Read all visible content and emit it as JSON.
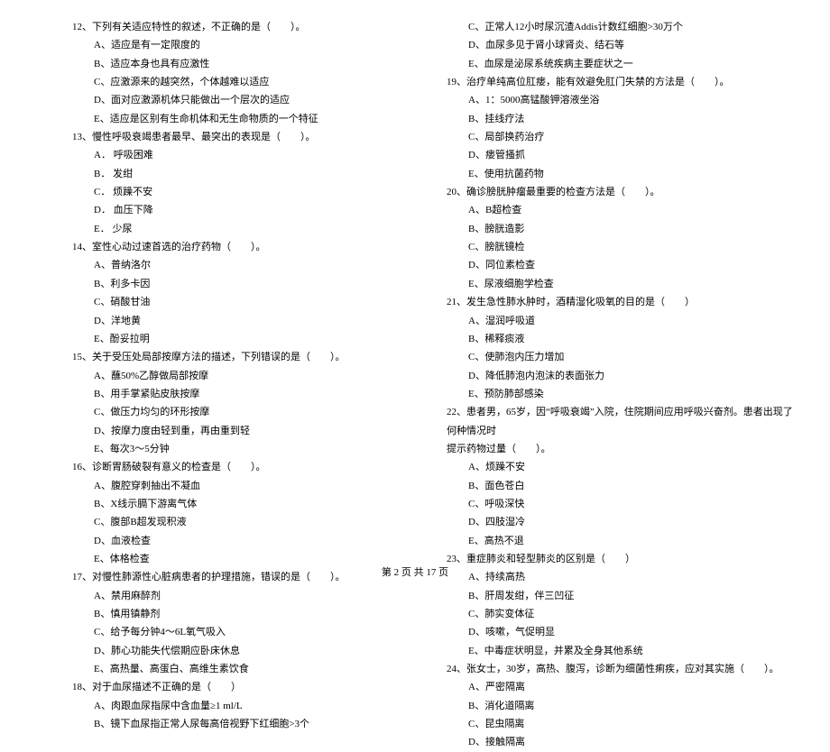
{
  "left": {
    "q12": {
      "stem": "12、下列有关适应特性的叙述，不正确的是（　　）。",
      "A": "A、适应是有一定限度的",
      "B": "B、适应本身也具有应激性",
      "C": "C、应激源来的越突然，个体越难以适应",
      "D": "D、面对应激源机体只能做出一个层次的适应",
      "E": "E、适应是区别有生命机体和无生命物质的一个特征"
    },
    "q13": {
      "stem": "13、慢性呼吸衰竭患者最早、最突出的表现是（　　）。",
      "A": "A． 呼吸困难",
      "B": "B． 发绀",
      "C": "C． 烦躁不安",
      "D": "D． 血压下降",
      "E": "E． 少尿"
    },
    "q14": {
      "stem": "14、室性心动过速首选的治疗药物（　　）。",
      "A": "A、普纳洛尔",
      "B": "B、利多卡因",
      "C": "C、硝酸甘油",
      "D": "D、洋地黄",
      "E": "E、酚妥拉明"
    },
    "q15": {
      "stem": "15、关于受压处局部按摩方法的描述，下列错误的是（　　）。",
      "A": "A、蘸50%乙醇做局部按摩",
      "B": "B、用手掌紧贴皮肤按摩",
      "C": "C、做压力均匀的环形按摩",
      "D": "D、按摩力度由轻到重，再由重到轻",
      "E": "E、每次3～5分钟"
    },
    "q16": {
      "stem": "16、诊断胃肠破裂有意义的检查是（　　）。",
      "A": "A、腹腔穿刺抽出不凝血",
      "B": "B、X线示膈下游离气体",
      "C": "C、腹部B超发现积液",
      "D": "D、血液检查",
      "E": "E、体格检查"
    },
    "q17": {
      "stem": "17、对慢性肺源性心脏病患者的护理措施，错误的是（　　）。",
      "A": "A、禁用麻醉剂",
      "B": "B、慎用镇静剂",
      "C": "C、给予每分钟4～6L氧气吸入",
      "D": "D、肺心功能失代偿期应卧床休息",
      "E": "E、高热量、高蛋白、高维生素饮食"
    },
    "q18": {
      "stem": "18、对于血尿描述不正确的是（　　）",
      "A": "A、肉跟血尿指尿中含血量≥1 ml/L",
      "B": "B、镜下血尿指正常人尿每高倍视野下红细胞>3个"
    }
  },
  "right": {
    "q18cont": {
      "C": "C、正常人12小时尿沉渣Addis计数红细胞>30万个",
      "D": "D、血尿多见于肾小球肾炎、结石等",
      "E": "E、血尿是泌尿系统疾病主要症状之一"
    },
    "q19": {
      "stem": "19、治疗单纯高位肛瘘，能有效避免肛门失禁的方法是（　　）。",
      "A": "A、1：5000高锰酸钾溶液坐浴",
      "B": "B、挂线疗法",
      "C": "C、局部换药治疗",
      "D": "D、瘘管搔抓",
      "E": "E、使用抗菌药物"
    },
    "q20": {
      "stem": "20、确诊膀胱肿瘤最重要的检查方法是（　　）。",
      "A": "A、B超检查",
      "B": "B、膀胱造影",
      "C": "C、膀胱镜检",
      "D": "D、同位素检查",
      "E": "E、尿液细胞学检查"
    },
    "q21": {
      "stem": "21、发生急性肺水肿时，酒精湿化吸氧的目的是（　　）",
      "A": "A、湿润呼吸道",
      "B": "B、稀释痰液",
      "C": "C、使肺泡内压力增加",
      "D": "D、降低肺泡内泡沫的表面张力",
      "E": "E、预防肺部感染"
    },
    "q22": {
      "stem1": "22、患者男，65岁，因“呼吸衰竭”入院，住院期间应用呼吸兴奋剂。患者出现了何种情况时",
      "stem2": "提示药物过量（　　）。",
      "A": "A、烦躁不安",
      "B": "B、面色苍白",
      "C": "C、呼吸深快",
      "D": "D、四肢湿冷",
      "E": "E、高热不退"
    },
    "q23": {
      "stem": "23、重症肺炎和轻型肺炎的区别是（　　）",
      "A": "A、持续高热",
      "B": "B、肝周发绀，伴三凹征",
      "C": "C、肺实变体征",
      "D": "D、咳嗽，气促明显",
      "E": "E、中毒症状明显，并累及全身其他系统"
    },
    "q24": {
      "stem": "24、张女士，30岁，高热、腹泻，诊断为细菌性痢疾，应对其实施（　　）。",
      "A": "A、严密隔离",
      "B": "B、消化道隔离",
      "C": "C、昆虫隔离",
      "D": "D、接触隔离"
    }
  },
  "footer": "第 2 页 共 17 页"
}
